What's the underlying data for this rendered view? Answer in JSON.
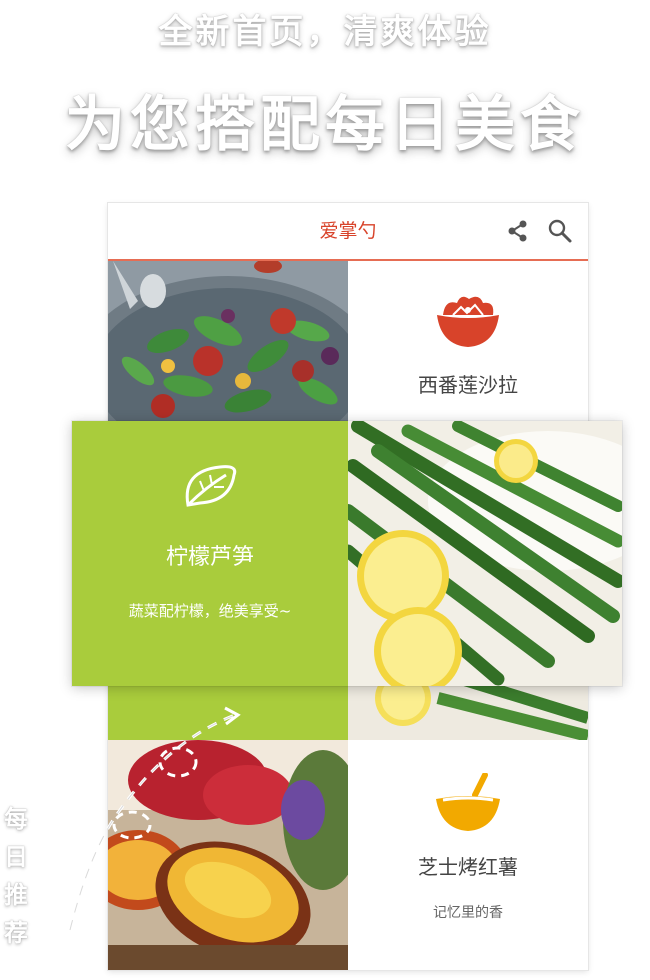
{
  "promo": {
    "tagline": "全新首页，清爽体验",
    "headline": "为您搭配每日美食"
  },
  "app": {
    "title": "爱掌勺",
    "accent_color": "#d8432a",
    "share_icon": "share-icon",
    "search_icon": "search-icon"
  },
  "cards": [
    {
      "title": "西番莲沙拉",
      "icon": "salad-bowl-icon",
      "icon_color": "#d8432a"
    },
    {
      "title": "柠檬芦笋",
      "subtitle": "蔬菜配柠檬，绝美享受~",
      "icon": "leaf-icon",
      "bg_color": "#a9cc3c"
    },
    {
      "title": "芝士烤红薯",
      "subtitle": "记忆里的香",
      "icon": "bowl-icon",
      "icon_color": "#f2a900"
    }
  ],
  "side_label": [
    "每",
    "日",
    "推",
    "荐"
  ]
}
